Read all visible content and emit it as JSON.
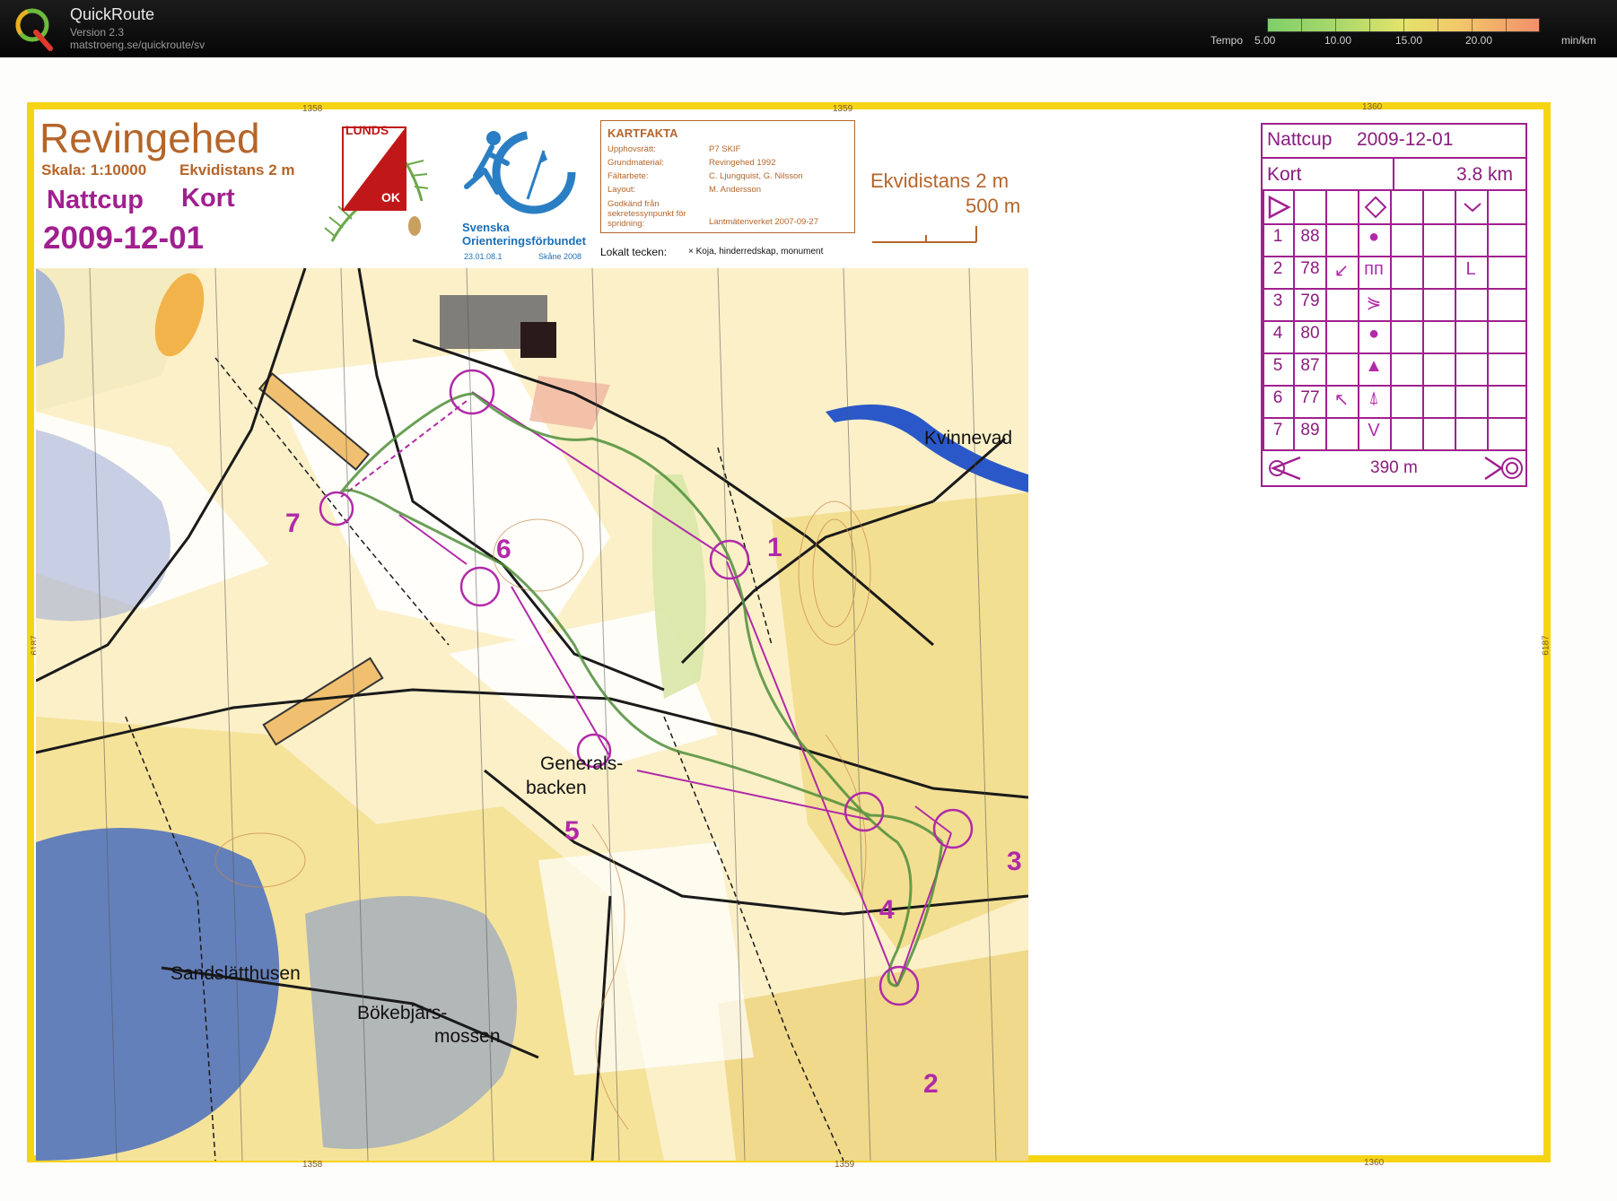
{
  "app": {
    "name": "QuickRoute",
    "version": "Version 2.3",
    "url": "matstroeng.se/quickroute/sv",
    "logo_letter": "Q",
    "logo_icon": "quickroute-q-logo"
  },
  "tempo": {
    "label": "Tempo",
    "ticks": [
      "5.00",
      "10.00",
      "15.00",
      "20.00"
    ],
    "unit": "min/km",
    "colors": [
      "#7fcf6a",
      "#e4e36a",
      "#f3906a"
    ]
  },
  "map": {
    "title": "Revingehed",
    "scale": "Skala: 1:10000",
    "contour": "Ekvidistans 2 m",
    "event": "Nattcup",
    "course": "Kort",
    "date": "2009-12-01",
    "grid_labels_top": [
      "1358",
      "1359",
      "1360"
    ],
    "grid_labels_bottom": [
      "1358",
      "1359",
      "1360"
    ],
    "grid_label_side": "6187",
    "club": {
      "line1": "LUNDS",
      "line2": "OK"
    },
    "federation": {
      "name": "Svenska Orienteringsförbundet",
      "date": "23.01.08.1",
      "region": "Skåne 2008"
    },
    "kartfakta": {
      "title": "KARTFAKTA",
      "rows": [
        {
          "key": "Upphovsrätt:",
          "value": "P7 SKIF"
        },
        {
          "key": "Grundmaterial:",
          "value": "Revingehed 1992"
        },
        {
          "key": "Fältarbete:",
          "value": "C. Ljungquist, G. Nilsson"
        },
        {
          "key": "Layout:",
          "value": "M. Andersson"
        },
        {
          "key": "Godkänd från sekretessynpunkt för spridning:",
          "value": "Lantmäteriverket 2007-09-27"
        }
      ],
      "local_symbols_label": "Lokalt tecken:",
      "local_symbols_detail": "× Koja, hinderredskap, monument"
    },
    "scale_block": {
      "contour": "Ekvidistans 2 m",
      "bar_label": "500 m"
    },
    "place_names": [
      "Kvinnevad",
      "Generals-",
      "backen",
      "Sandslätthusen",
      "Bökebjärs-",
      "mossen"
    ],
    "controls": [
      "1",
      "2",
      "3",
      "4",
      "5",
      "6",
      "7"
    ],
    "colors": {
      "course": "#b12aa8",
      "route": "#4f8f3a",
      "border": "#f6d414"
    }
  },
  "description": {
    "event": "Nattcup",
    "date": "2009-12-01",
    "course": "Kort",
    "length": "3.8 km",
    "rows": [
      {
        "num": "1",
        "code": "88",
        "dir": "",
        "feature": "●",
        "extra": ""
      },
      {
        "num": "2",
        "code": "78",
        "dir": "↙",
        "feature": "ᴨᴨ",
        "extra": "L"
      },
      {
        "num": "3",
        "code": "79",
        "dir": "",
        "feature": "⋟",
        "extra": ""
      },
      {
        "num": "4",
        "code": "80",
        "dir": "",
        "feature": "●",
        "extra": ""
      },
      {
        "num": "5",
        "code": "87",
        "dir": "",
        "feature": "▲",
        "extra": ""
      },
      {
        "num": "6",
        "code": "77",
        "dir": "↖",
        "feature": "⍋",
        "extra": ""
      },
      {
        "num": "7",
        "code": "89",
        "dir": "",
        "feature": "V",
        "extra": ""
      }
    ],
    "finish_distance": "390 m"
  }
}
